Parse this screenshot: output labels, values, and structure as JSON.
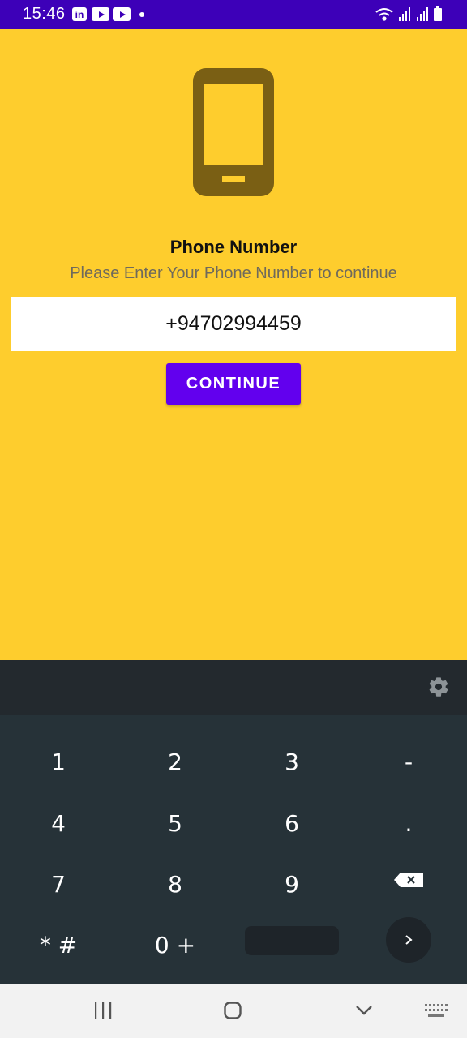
{
  "status_bar": {
    "time": "15:46",
    "app_icons": [
      "linkedin-icon",
      "youtube-icon",
      "youtube-icon"
    ],
    "indicators": [
      "wifi-icon",
      "signal-icon",
      "signal-icon",
      "battery-icon"
    ],
    "background": "#3d00b8"
  },
  "main": {
    "icon": "smartphone-icon",
    "title": "Phone Number",
    "subtitle": "Please Enter Your Phone Number to continue",
    "phone_input_value": "+94702994459",
    "continue_label": "CONTINUE",
    "background": "#fecd2d",
    "button_color": "#6200ee"
  },
  "keyboard": {
    "toolbar_icon": "gear-icon",
    "rows": [
      [
        "1",
        "2",
        "3",
        "-"
      ],
      [
        "4",
        "5",
        "6",
        "."
      ],
      [
        "7",
        "8",
        "9",
        "backspace"
      ],
      [
        "* #",
        "0 +",
        "space",
        "go"
      ]
    ],
    "background": "#263238"
  },
  "nav_bar": {
    "buttons": [
      "recents-icon",
      "home-icon",
      "back-icon",
      "keyboard-icon"
    ]
  }
}
